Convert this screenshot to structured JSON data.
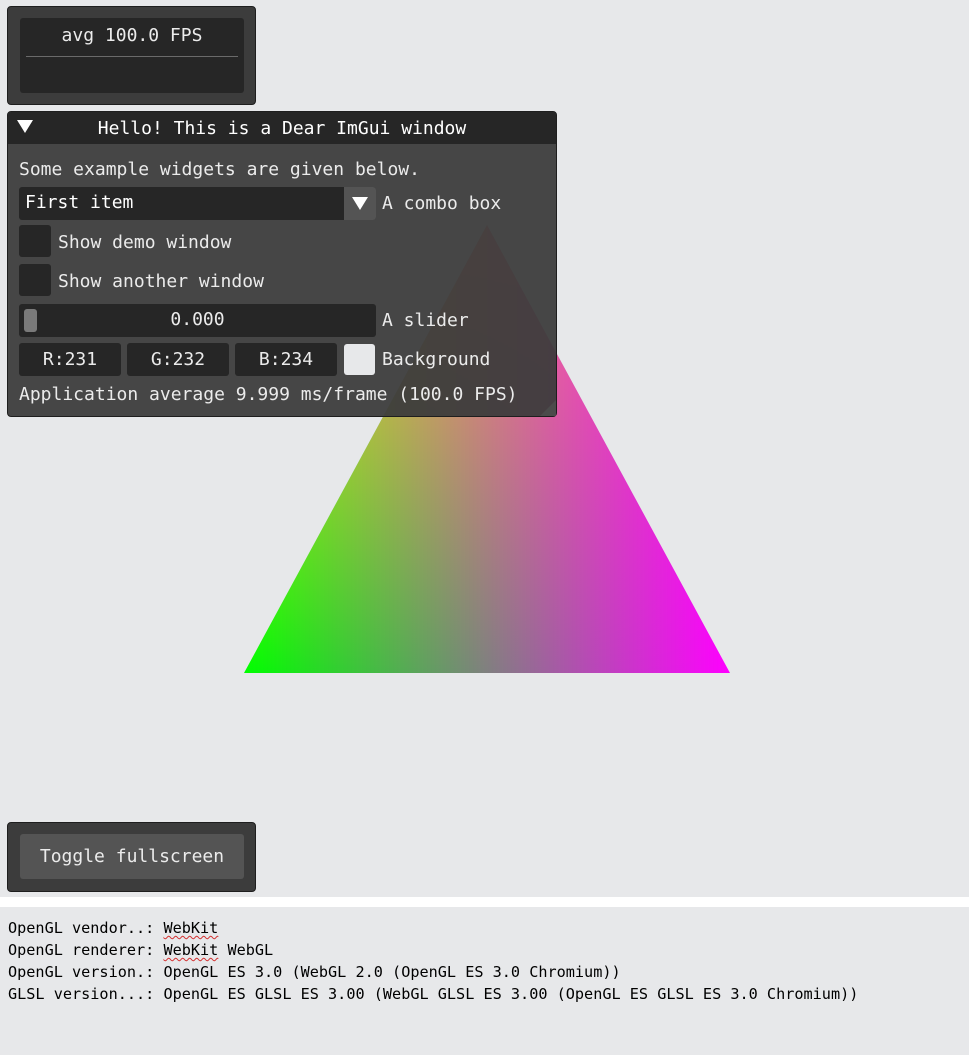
{
  "colors": {
    "background": "#e7e8ea",
    "imgui_window": "#3c3c3c",
    "imgui_frame": "#262626",
    "imgui_button": "#545454",
    "imgui_text": "#ebebeb",
    "triangle_top": "#ff0000",
    "triangle_left": "#00ff00",
    "triangle_right": "#ff00ff"
  },
  "fps_overlay": {
    "text": "avg 100.0 FPS"
  },
  "hello_window": {
    "title": "Hello! This is a Dear ImGui window",
    "intro_text": "Some example widgets are given below.",
    "combo": {
      "value": "First item",
      "label": "A combo box"
    },
    "show_demo_window": {
      "label": "Show demo window",
      "checked": false
    },
    "show_another_window": {
      "label": "Show another window",
      "checked": false
    },
    "slider": {
      "value": "0.000",
      "label": "A slider"
    },
    "color_edit": {
      "r": "R:231",
      "g": "G:232",
      "b": "B:234",
      "label": "Background",
      "swatch_color": "#e7e8ea"
    },
    "status_text": "Application average 9.999 ms/frame (100.0 FPS)"
  },
  "toggle_fullscreen": {
    "label": "Toggle fullscreen"
  },
  "gl_info": {
    "vendor_label": "OpenGL vendor..: ",
    "vendor_value": "WebKit",
    "renderer_label": "OpenGL renderer: ",
    "renderer_value_1": "WebKit",
    "renderer_value_2": " WebGL",
    "version_label": "OpenGL version.: ",
    "version_value": "OpenGL ES 3.0 (WebGL 2.0 (OpenGL ES 3.0 Chromium))",
    "glsl_label": "GLSL version...: ",
    "glsl_value": "OpenGL ES GLSL ES 3.00 (WebGL GLSL ES 3.00 (OpenGL ES GLSL ES 3.0 Chromium))"
  }
}
